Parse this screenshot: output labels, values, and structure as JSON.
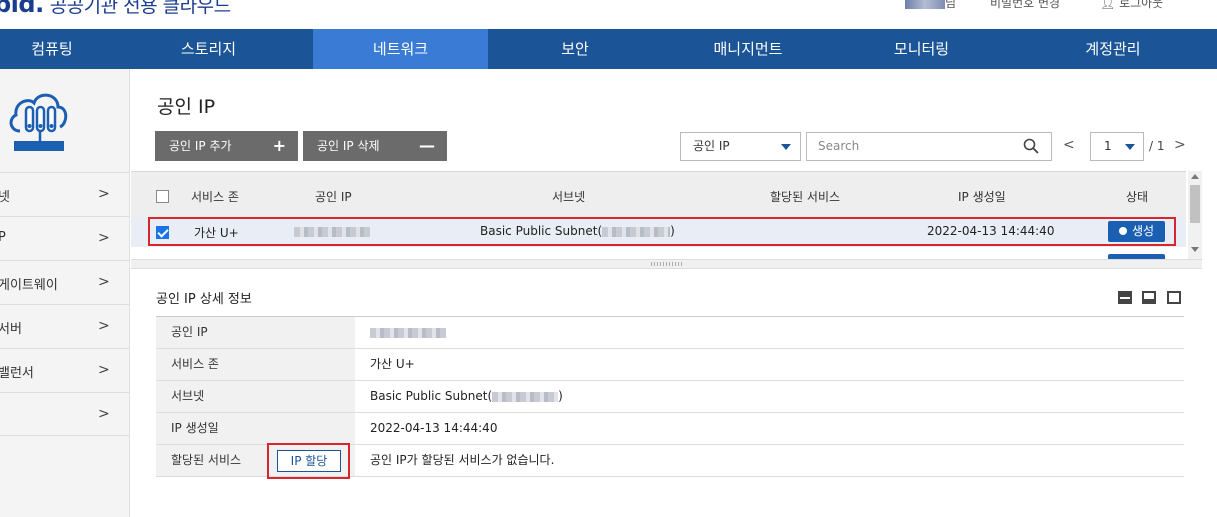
{
  "header": {
    "logo": "bld.",
    "subtitle": "공공기관 전용 클라우드",
    "user_suffix": "님",
    "change_password": "비밀번호 변경",
    "logout": "로그아웃"
  },
  "nav": {
    "items": [
      {
        "label": "컴퓨팅"
      },
      {
        "label": "스토리지"
      },
      {
        "label": "네트워크",
        "active": true
      },
      {
        "label": "보안"
      },
      {
        "label": "매니지먼트"
      },
      {
        "label": "모니터링"
      },
      {
        "label": "계정관리"
      }
    ]
  },
  "sidebar": {
    "items": [
      {
        "label": "넷"
      },
      {
        "label": "P"
      },
      {
        "label": "게이트웨이"
      },
      {
        "label": "서버"
      },
      {
        "label": "밸런서"
      },
      {
        "label": ""
      }
    ]
  },
  "main": {
    "title": "공인 IP",
    "add_button": "공인 IP 추가",
    "add_symbol": "+",
    "delete_button": "공인 IP 삭제",
    "delete_symbol": "—",
    "filter_select": "공인 IP",
    "search_placeholder": "Search",
    "pager": {
      "current": "1",
      "total": "/ 1"
    }
  },
  "table": {
    "columns": [
      "서비스 존",
      "공인 IP",
      "서브넷",
      "할당된 서비스",
      "IP 생성일",
      "상태"
    ],
    "rows": [
      {
        "checked": true,
        "zone": "가산 U+",
        "subnet": "Basic Public Subnet(",
        "subnet_close": ")",
        "assigned_service": "",
        "created": "2022-04-13 14:44:40",
        "status": "생성"
      }
    ]
  },
  "detail": {
    "title": "공인 IP 상세 정보",
    "rows": [
      {
        "label": "공인 IP",
        "value": ""
      },
      {
        "label": "서비스 존",
        "value": "가산 U+"
      },
      {
        "label": "서브넷",
        "value": "Basic Public Subnet(",
        "value_close": ")"
      },
      {
        "label": "IP 생성일",
        "value": "2022-04-13 14:44:40"
      },
      {
        "label": "할당된 서비스",
        "button": "IP 할당",
        "value": "공인 IP가 할당된 서비스가 없습니다."
      }
    ]
  },
  "colors": {
    "nav_bg": "#1b5497",
    "nav_active": "#3a7bd5",
    "status_blue": "#1b5fb3",
    "highlight_red": "#d9262c"
  }
}
